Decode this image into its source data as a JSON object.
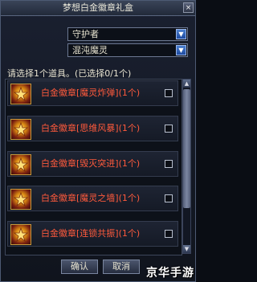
{
  "window": {
    "title": "梦想白金徽章礼盒",
    "close_glyph": "×"
  },
  "dropdowns": [
    {
      "value": "守护者"
    },
    {
      "value": "混沌魔灵"
    }
  ],
  "instruction": "请选择1个道具。(已选择0/1个)",
  "items": [
    {
      "name": "白金徽章[魔灵炸弹](1个)",
      "checked": false
    },
    {
      "name": "白金徽章[思维风暴](1个)",
      "checked": false
    },
    {
      "name": "白金徽章[毁灭突进](1个)",
      "checked": false
    },
    {
      "name": "白金徽章[魔灵之墙](1个)",
      "checked": false
    },
    {
      "name": "白金徽章[连锁共振](1个)",
      "checked": false
    }
  ],
  "buttons": {
    "confirm": "确认",
    "cancel": "取消"
  },
  "watermark": "京华手游",
  "colors": {
    "item_text": "#ff5a3c",
    "accent_arrow": "#2b5fbf"
  }
}
